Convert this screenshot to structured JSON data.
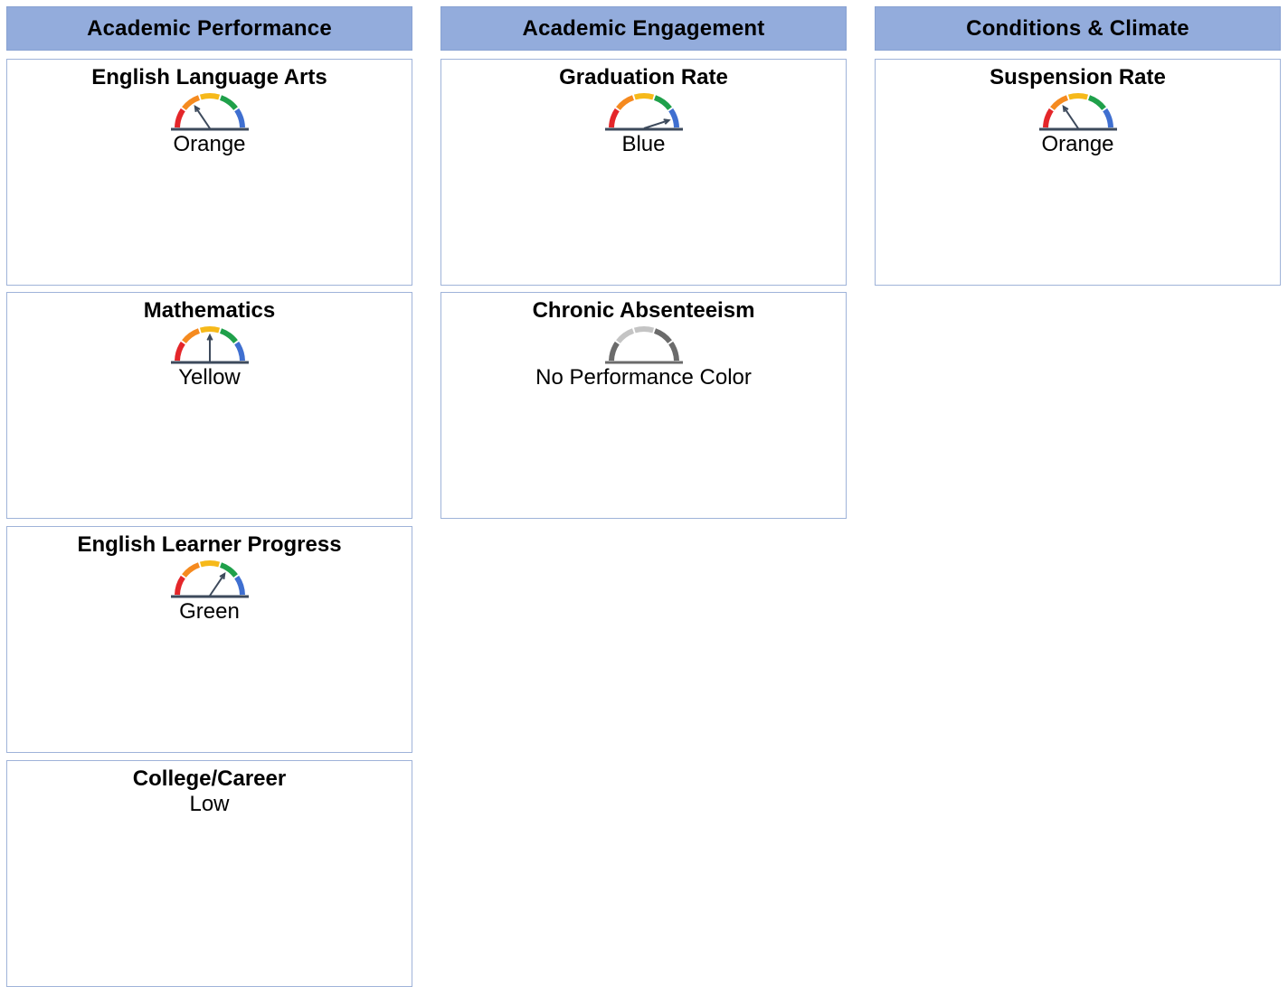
{
  "columns": [
    {
      "header": "Academic Performance",
      "cards": [
        {
          "title": "English Language Arts",
          "status": "Orange",
          "gauge": "orange"
        },
        {
          "title": "Mathematics",
          "status": "Yellow",
          "gauge": "yellow"
        },
        {
          "title": "English Learner Progress",
          "status": "Green",
          "gauge": "green"
        },
        {
          "title": "College/Career",
          "status": "Low",
          "gauge": "none"
        }
      ]
    },
    {
      "header": "Academic Engagement",
      "cards": [
        {
          "title": "Graduation Rate",
          "status": "Blue",
          "gauge": "blue"
        },
        {
          "title": "Chronic Absenteeism",
          "status": "No Performance Color",
          "gauge": "gray"
        }
      ]
    },
    {
      "header": "Conditions & Climate",
      "cards": [
        {
          "title": "Suspension Rate",
          "status": "Orange",
          "gauge": "orange"
        }
      ]
    }
  ],
  "colors": {
    "header_bg": "#93acdc",
    "card_border": "#9fb3d9",
    "red": "#e4262a",
    "orange": "#f58a1f",
    "yellow": "#f6b91a",
    "green": "#1fa04a",
    "blue": "#3f6fd0",
    "gray_dark": "#6b6b6b",
    "gray_light": "#c4c4c4",
    "needle": "#3d4a5c"
  }
}
